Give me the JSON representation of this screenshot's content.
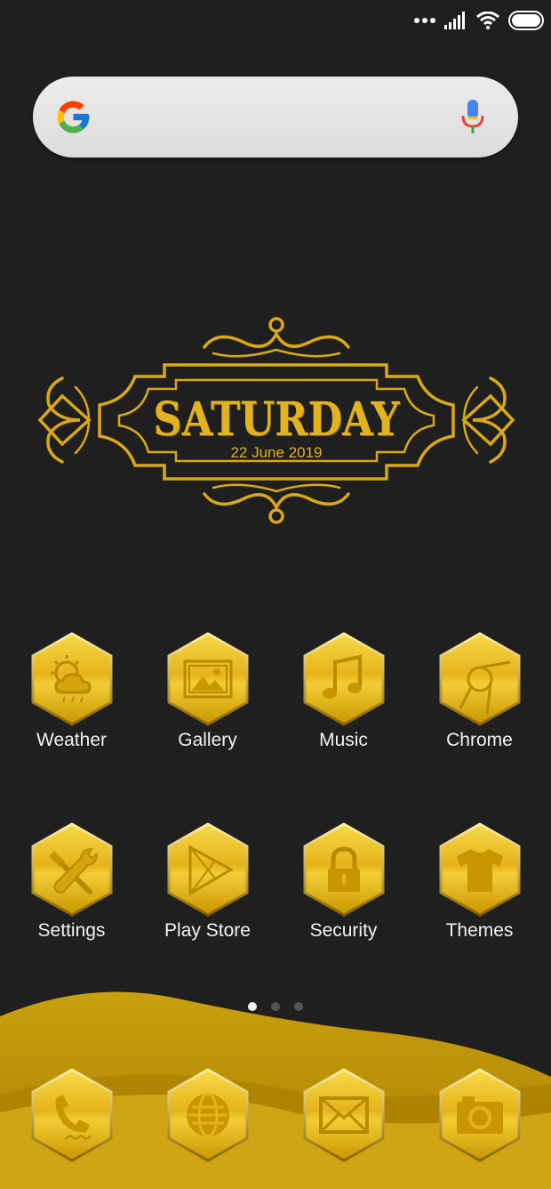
{
  "status_bar": {
    "icons": [
      "more-dots-icon",
      "cellular-signal-icon",
      "wifi-icon",
      "battery-icon"
    ]
  },
  "search": {
    "placeholder": "",
    "icons": [
      "google-logo-icon",
      "microphone-icon"
    ]
  },
  "date_widget": {
    "day": "SATURDAY",
    "date": "22 June 2019"
  },
  "apps": [
    {
      "label": "Weather",
      "icon": "weather-icon"
    },
    {
      "label": "Gallery",
      "icon": "gallery-icon"
    },
    {
      "label": "Music",
      "icon": "music-icon"
    },
    {
      "label": "Chrome",
      "icon": "chrome-icon"
    },
    {
      "label": "Settings",
      "icon": "settings-icon"
    },
    {
      "label": "Play Store",
      "icon": "play-store-icon"
    },
    {
      "label": "Security",
      "icon": "lock-icon"
    },
    {
      "label": "Themes",
      "icon": "tshirt-icon"
    }
  ],
  "page_indicator": {
    "pages": 3,
    "active": 1
  },
  "dock": [
    {
      "icon": "phone-icon"
    },
    {
      "icon": "browser-icon"
    },
    {
      "icon": "mail-icon"
    },
    {
      "icon": "camera-icon"
    }
  ],
  "colors": {
    "background": "#1f1f1f",
    "gold": "#e2b31f",
    "gold_dark": "#8a6a00",
    "label": "#f2f2f2"
  }
}
